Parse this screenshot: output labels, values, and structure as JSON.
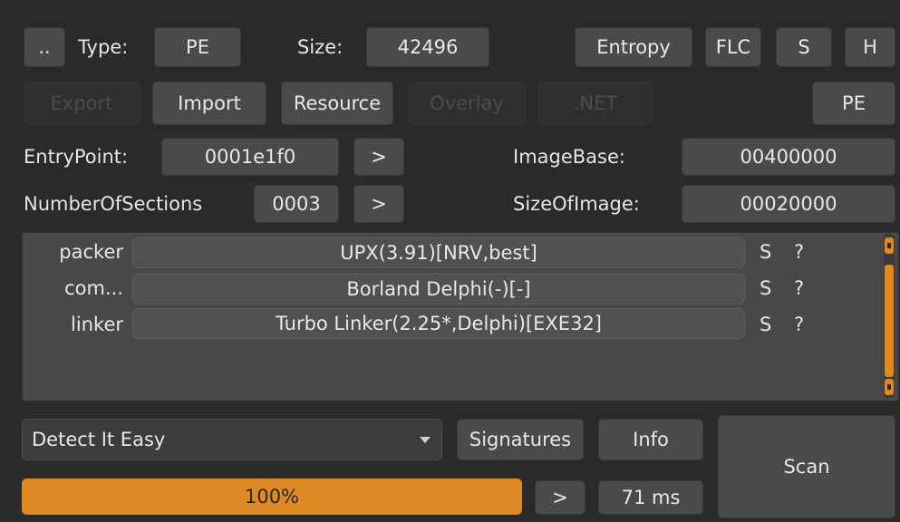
{
  "row1": {
    "up_label": "..",
    "type_label": "Type:",
    "type_value": "PE",
    "size_label": "Size:",
    "size_value": "42496",
    "entropy_label": "Entropy",
    "flc_label": "FLC",
    "s_label": "S",
    "h_label": "H"
  },
  "row2": {
    "export_label": "Export",
    "import_label": "Import",
    "resource_label": "Resource",
    "overlay_label": "Overlay",
    "net_label": ".NET",
    "pe_label": "PE"
  },
  "row3": {
    "entrypoint_label": "EntryPoint:",
    "entrypoint_value": "0001e1f0",
    "entrypoint_go": ">",
    "imagebase_label": "ImageBase:",
    "imagebase_value": "00400000"
  },
  "row4": {
    "sections_label": "NumberOfSections",
    "sections_value": "0003",
    "sections_go": ">",
    "sizeofimage_label": "SizeOfImage:",
    "sizeofimage_value": "00020000"
  },
  "detections": [
    {
      "type": "packer",
      "value": "UPX(3.91)[NRV,best]",
      "s": "S",
      "q": "?"
    },
    {
      "type": "com...",
      "value": "Borland Delphi(-)[-]",
      "s": "S",
      "q": "?"
    },
    {
      "type": "linker",
      "value": "Turbo Linker(2.25*,Delphi)[EXE32]",
      "s": "S",
      "q": "?"
    }
  ],
  "bottom": {
    "engine_selected": "Detect It Easy",
    "signatures_label": "Signatures",
    "info_label": "Info",
    "scan_label": "Scan",
    "progress_text": "100%",
    "progress_value": 100,
    "go_label": ">",
    "time_label": "71 ms"
  },
  "colors": {
    "accent": "#dd8a24",
    "background": "#2a2a2a",
    "button": "#4a4a4a"
  }
}
